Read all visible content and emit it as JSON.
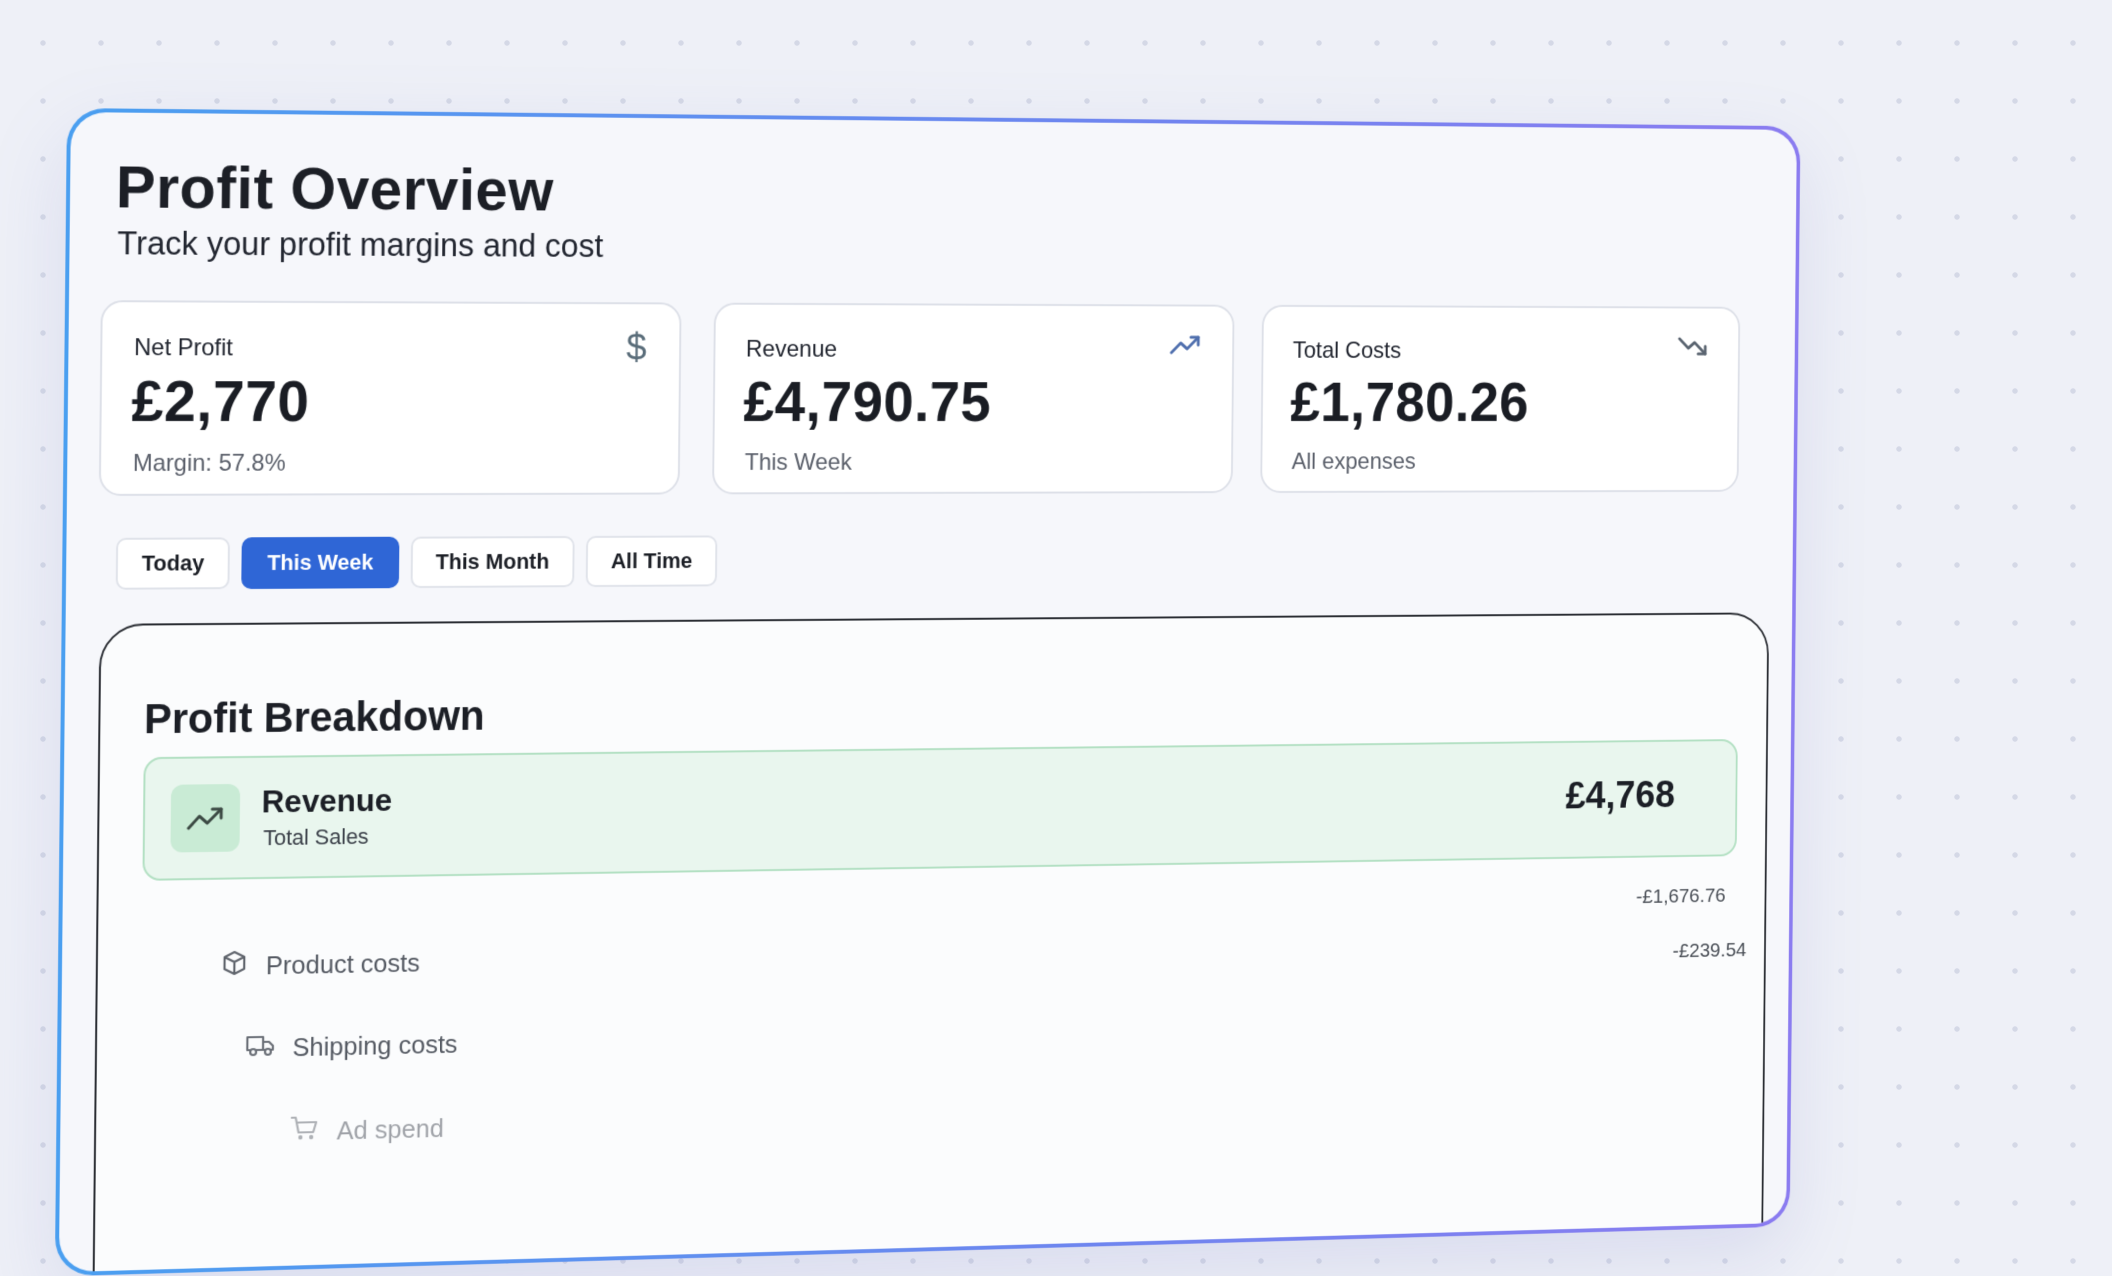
{
  "header": {
    "title": "Profit Overview",
    "subtitle": "Track your profit margins and cost"
  },
  "stats": [
    {
      "label": "Net Profit",
      "value": "£2,770",
      "sub": "Margin: 57.8%",
      "icon": "dollar-icon"
    },
    {
      "label": "Revenue",
      "value": "£4,790.75",
      "sub": "This Week",
      "icon": "trend-up-icon"
    },
    {
      "label": "Total Costs",
      "value": "£1,780.26",
      "sub": "All expenses",
      "icon": "trend-down-icon"
    }
  ],
  "filters": {
    "options": [
      "Today",
      "This Week",
      "This Month",
      "All Time"
    ],
    "selected": "This Week"
  },
  "breakdown": {
    "title": "Profit Breakdown",
    "revenue": {
      "label": "Revenue",
      "sub": "Total Sales",
      "amount": "£4,768",
      "icon": "trend-up-icon"
    },
    "costs": [
      {
        "label": "Product costs",
        "amount": "-£1,676.76",
        "icon": "package-icon"
      },
      {
        "label": "Shipping costs",
        "amount": "-£239.54",
        "icon": "truck-icon"
      },
      {
        "label": "Ad spend",
        "icon": "cart-icon"
      }
    ]
  },
  "colors": {
    "accent": "#2f66d6",
    "revenue_bg": "#e9f6ee",
    "revenue_border": "#b3e0c3",
    "frame_gradient_start": "#4a9ff0",
    "frame_gradient_end": "#8b7cf0"
  }
}
